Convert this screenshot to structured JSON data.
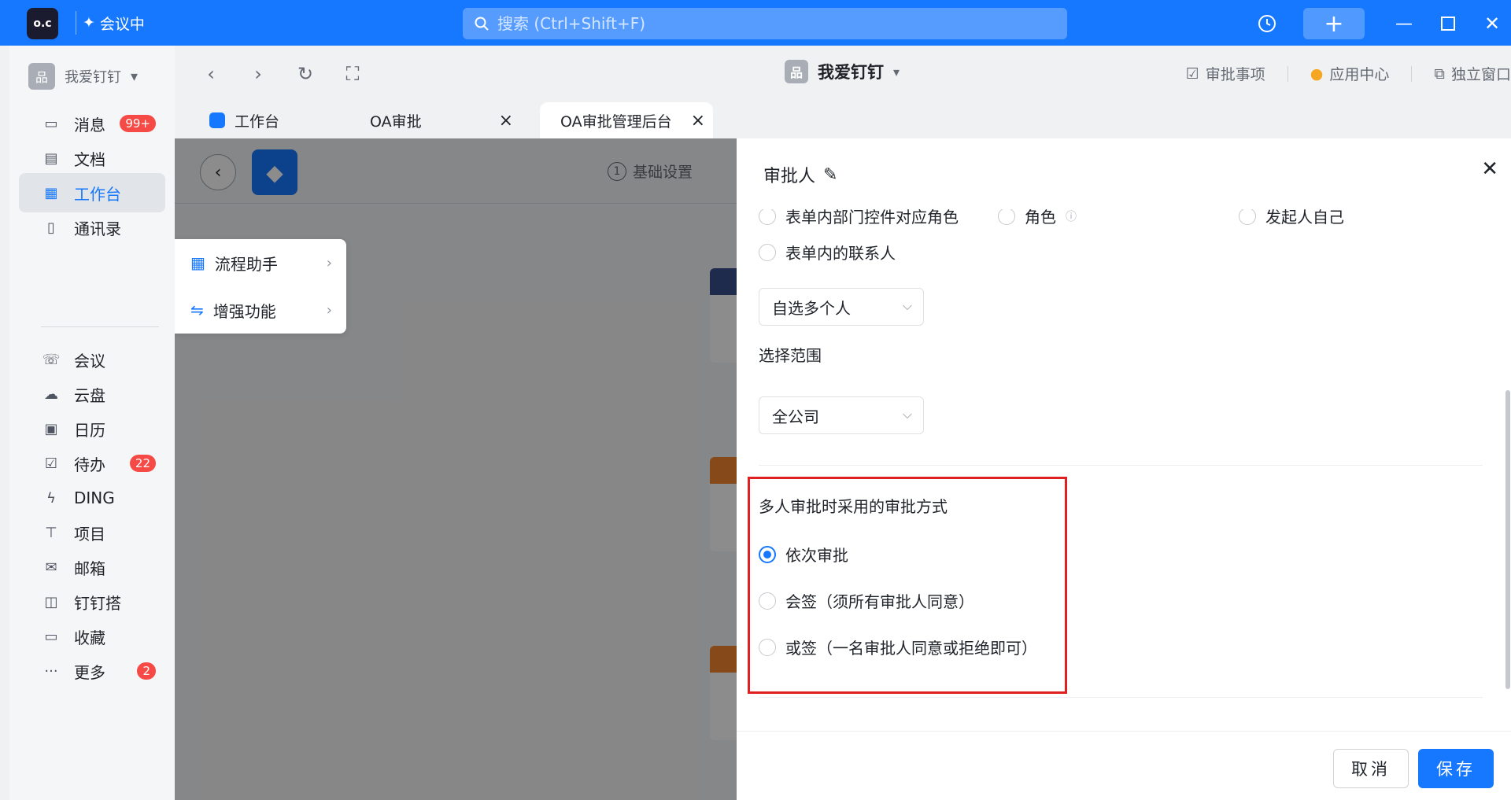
{
  "titlebar": {
    "logo_text": "o.c",
    "meeting_label": "会议中",
    "search_placeholder": "搜索 (Ctrl+Shift+F)"
  },
  "sidebar": {
    "org_name": "我爱钉钉",
    "items": [
      {
        "label": "消息",
        "icon": "chat-icon",
        "badge": "99+"
      },
      {
        "label": "文档",
        "icon": "document-icon",
        "badge": ""
      },
      {
        "label": "工作台",
        "icon": "grid-icon",
        "badge": ""
      },
      {
        "label": "通讯录",
        "icon": "contacts-icon",
        "badge": ""
      },
      {
        "label": "会议",
        "icon": "phone-icon",
        "badge": ""
      },
      {
        "label": "云盘",
        "icon": "cloud-icon",
        "badge": ""
      },
      {
        "label": "日历",
        "icon": "calendar-icon",
        "badge": ""
      },
      {
        "label": "待办",
        "icon": "todo-icon",
        "badge": "22"
      },
      {
        "label": "DING",
        "icon": "lightning-icon",
        "badge": ""
      },
      {
        "label": "项目",
        "icon": "project-icon",
        "badge": ""
      },
      {
        "label": "邮箱",
        "icon": "mail-icon",
        "badge": ""
      },
      {
        "label": "钉钉搭",
        "icon": "builder-icon",
        "badge": ""
      },
      {
        "label": "收藏",
        "icon": "bookmark-icon",
        "badge": ""
      },
      {
        "label": "更多",
        "icon": "more-icon",
        "badge": "2"
      }
    ]
  },
  "toolbar": {
    "org_name": "我爱钉钉",
    "links": [
      "审批事项",
      "应用中心",
      "独立窗口"
    ]
  },
  "tabs": [
    {
      "label": "工作台"
    },
    {
      "label": "OA审批"
    },
    {
      "label": "OA审批管理后台"
    }
  ],
  "content": {
    "step_number": "1",
    "step_label": "基础设置",
    "flow_menu": [
      "流程助手",
      "增强功能"
    ]
  },
  "drawer": {
    "title": "审批人",
    "top_options": [
      "表单内部门控件对应角色",
      "角色",
      "发起人自己"
    ],
    "contact_option": "表单内的联系人",
    "select_mode": "自选多个人",
    "range_label": "选择范围",
    "range_value": "全公司",
    "method_label": "多人审批时采用的审批方式",
    "method_options": [
      {
        "label": "依次审批",
        "checked": true
      },
      {
        "label": "会签（须所有审批人同意）",
        "checked": false
      },
      {
        "label": "或签（一名审批人同意或拒绝即可）",
        "checked": false
      }
    ],
    "cancel_label": "取消",
    "save_label": "保存"
  },
  "colors": {
    "brand": "#1677ff",
    "badge": "#f54a45",
    "highlight": "#e02020"
  }
}
